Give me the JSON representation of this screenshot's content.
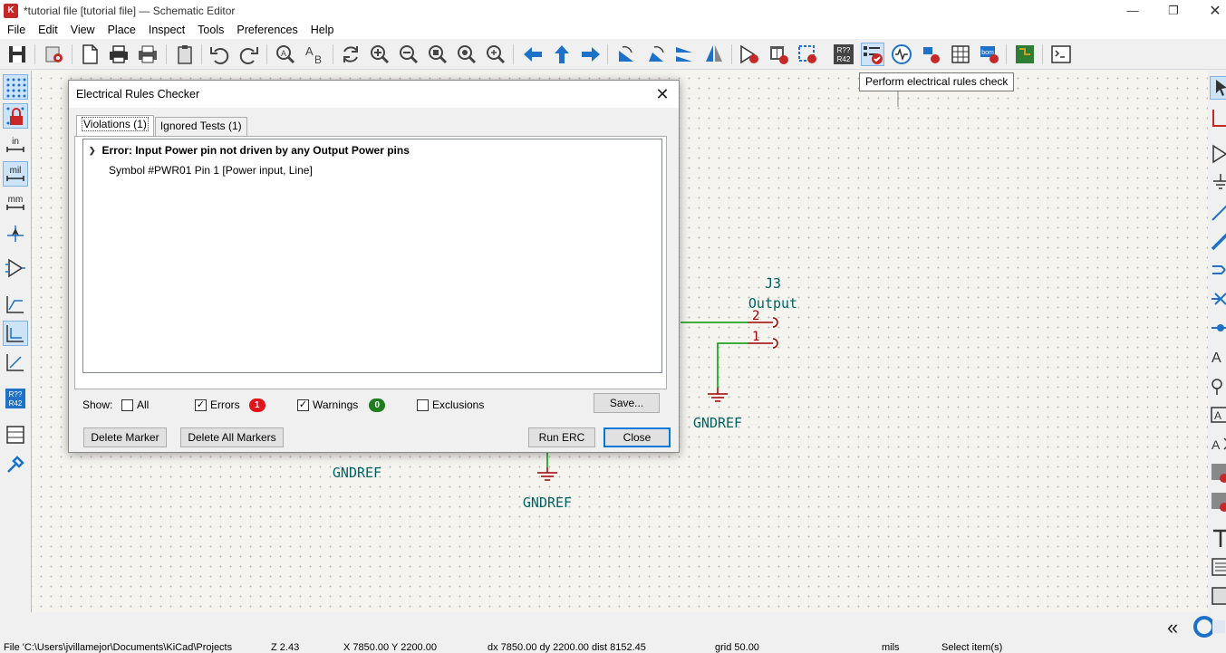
{
  "window": {
    "title": "*tutorial file [tutorial file] — Schematic Editor",
    "app_icon_letter": "K",
    "controls": [
      "minimize",
      "restore",
      "close"
    ]
  },
  "menu": [
    "File",
    "Edit",
    "View",
    "Place",
    "Inspect",
    "Tools",
    "Preferences",
    "Help"
  ],
  "toolbar": {
    "items": [
      "save-icon",
      "schematic-setup-icon",
      "page-settings-icon",
      "print-icon",
      "plot-icon",
      "paste-icon",
      "undo-icon",
      "redo-icon",
      "find-icon",
      "find-replace-icon",
      "refresh-icon",
      "zoom-in-icon",
      "zoom-out-icon",
      "zoom-fit-icon",
      "zoom-objects-icon",
      "zoom-selection-icon",
      "navigate-back-icon",
      "navigate-up-icon",
      "navigate-forward-icon",
      "rotate-ccw-icon",
      "rotate-cw-icon",
      "mirror-vertical-icon",
      "mirror-horizontal-icon",
      "symbol-editor-icon",
      "symbol-browser-icon",
      "footprint-assign-icon",
      "annotate-icon",
      "erc-icon",
      "simulator-icon",
      "netlist-icon",
      "bom-table-icon",
      "bom-generate-icon",
      "pcb-editor-icon",
      "scripting-console-icon"
    ],
    "annotate_label_top": "R??",
    "annotate_label_bottom": "R42",
    "bom_label": "bom",
    "tooltip": "Perform electrical rules check"
  },
  "left_toolbar": {
    "units": {
      "in": "in",
      "mil": "mil",
      "mm": "mm"
    },
    "annotate_top": "R??",
    "annotate_bottom": "R42"
  },
  "schematic": {
    "connector_ref": "J3",
    "connector_value": "Output",
    "pin2": "2",
    "pin1": "1",
    "gnd_labels": [
      "GNDREF",
      "GNDREF",
      "GNDREF"
    ]
  },
  "erc_dialog": {
    "title": "Electrical Rules Checker",
    "tabs": [
      {
        "label": "Violations (1)",
        "active": true
      },
      {
        "label": "Ignored Tests (1)",
        "active": false
      }
    ],
    "violation": {
      "error": "Error: Input Power pin not driven by any Output Power pins",
      "detail": "Symbol #PWR01 Pin 1 [Power input, Line]"
    },
    "show_label": "Show:",
    "filters": {
      "all": {
        "label": "All",
        "checked": false
      },
      "errors": {
        "label": "Errors",
        "checked": true,
        "count": "1"
      },
      "warnings": {
        "label": "Warnings",
        "checked": true,
        "count": "0"
      },
      "exclusions": {
        "label": "Exclusions",
        "checked": false
      }
    },
    "buttons": {
      "save": "Save...",
      "delete_marker": "Delete Marker",
      "delete_all": "Delete All Markers",
      "run": "Run ERC",
      "close": "Close"
    },
    "colors": {
      "error_badge": "#e0121a",
      "warning_badge": "#1e7d1e"
    }
  },
  "statusbar": {
    "file": "File 'C:\\Users\\jvillamejor\\Documents\\KiCad\\Projects",
    "zoom": "Z 2.43",
    "coords": "X 7850.00  Y 2200.00",
    "delta": "dx 7850.00  dy 2200.00  dist 8152.45",
    "grid": "grid 50.00",
    "units": "mils",
    "mode": "Select item(s)"
  },
  "colors": {
    "canvas": "#f5f4ef",
    "wire": "#009600",
    "pin": "#a00000",
    "text": "#006464",
    "accent_blue": "#1d71c8"
  }
}
